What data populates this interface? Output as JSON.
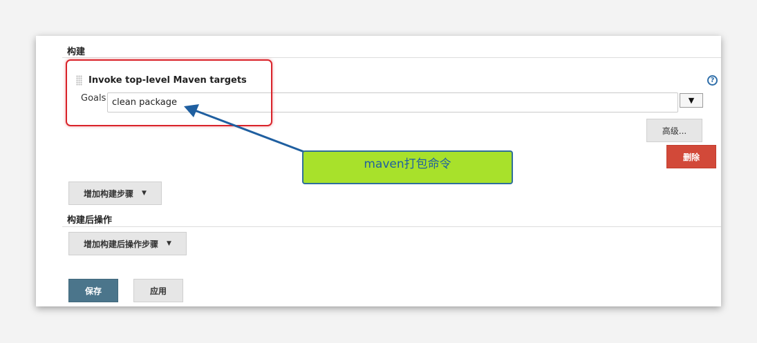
{
  "build": {
    "section_title": "构建",
    "step": {
      "title": "Invoke top-level Maven targets",
      "goals_label": "Goals",
      "goals_value": "clean package",
      "expand_glyph": "▼",
      "help_glyph": "?",
      "advanced_label": "高级...",
      "delete_label": "删除"
    },
    "add_step_label": "增加构建步骤",
    "add_step_caret": "▼"
  },
  "post_build": {
    "section_title": "构建后操作",
    "add_step_label": "增加构建后操作步骤",
    "add_step_caret": "▼"
  },
  "actions": {
    "save_label": "保存",
    "apply_label": "应用"
  },
  "annotation": {
    "callout_text": "maven打包命令"
  },
  "colors": {
    "delete_button": "#d24939",
    "save_button": "#4b758b",
    "callout_fill": "#a8e12b",
    "callout_border": "#2f6e9a",
    "highlight_border": "#d9232a"
  }
}
